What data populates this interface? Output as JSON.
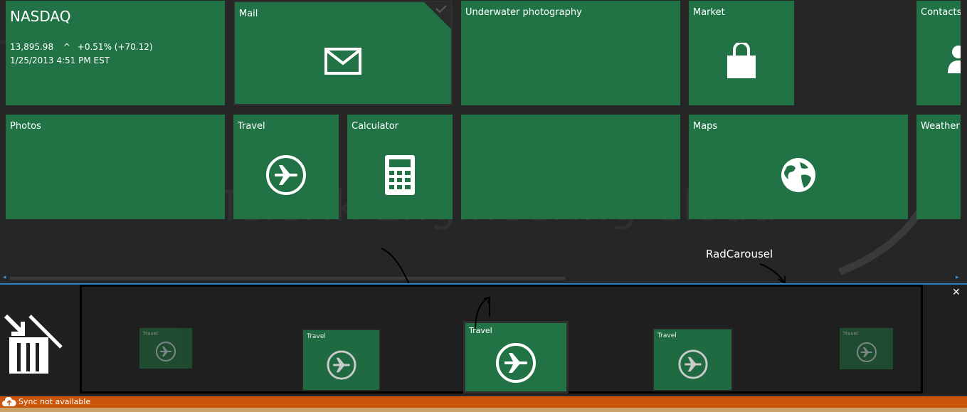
{
  "watermark": "Telerik Engineering Cloud",
  "tiles": {
    "nasdaq": {
      "title": "NASDAQ",
      "value": "13,895.98",
      "change_arrow": "^",
      "change": "+0.51% (+70.12)",
      "timestamp": "1/25/2013 4:51 PM EST"
    },
    "mail": {
      "label": "Mail",
      "icon": "mail-icon"
    },
    "underwater": {
      "label": "Underwater photography"
    },
    "market": {
      "label": "Market",
      "icon": "shopping-bag-icon"
    },
    "contacts": {
      "label": "Contacts",
      "icon": "person-icon"
    },
    "photos": {
      "label": "Photos"
    },
    "travel": {
      "label": "Travel",
      "icon": "airplane-icon"
    },
    "calculator": {
      "label": "Calculator",
      "icon": "calculator-icon"
    },
    "maps": {
      "label": "Maps",
      "icon": "globe-icon"
    },
    "weather": {
      "label": "Weather"
    }
  },
  "annotation": {
    "label": "RadCarousel"
  },
  "carousel": {
    "items": [
      {
        "label": "Travel"
      },
      {
        "label": "Travel"
      },
      {
        "label": "Travel"
      },
      {
        "label": "Travel"
      },
      {
        "label": "Travel"
      }
    ]
  },
  "statusbar": {
    "text": "Sync not available"
  },
  "colors": {
    "tile": "#217346",
    "status": "#c9560b",
    "accent": "#2d7fc6"
  }
}
